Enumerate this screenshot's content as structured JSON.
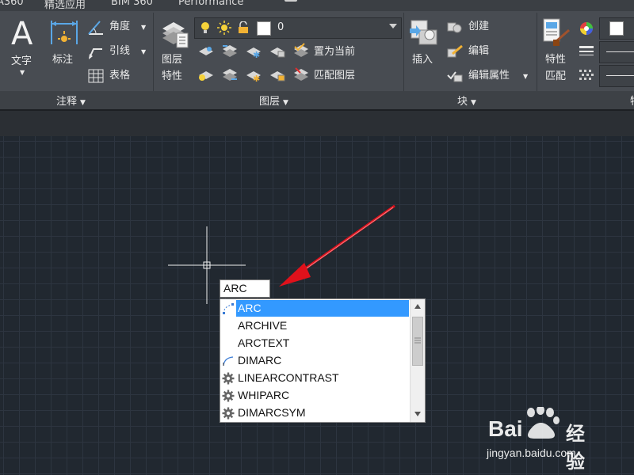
{
  "tabs": [
    "A360",
    "精选应用",
    "BIM 360",
    "Performance"
  ],
  "annotation_panel": {
    "title": "注释",
    "text_label": "文字",
    "dim_label": "标注",
    "angle_label": "角度",
    "leader_label": "引线",
    "table_label": "表格"
  },
  "layers_panel": {
    "title": "图层",
    "layer_props_label_1": "图层",
    "layer_props_label_2": "特性",
    "current_layer": "0",
    "set_current_label": "置为当前",
    "match_layer_label": "匹配图层"
  },
  "block_panel": {
    "title": "块",
    "insert_label": "插入",
    "create_label": "创建",
    "edit_label": "编辑",
    "edit_attr_label": "编辑属性"
  },
  "properties_panel": {
    "match_label_1": "特性",
    "match_label_2": "匹配",
    "title_partial": "特"
  },
  "command": {
    "input_value": "ARC",
    "suggestions": [
      {
        "name": "ARC",
        "icon": "arc-icon",
        "selected": true
      },
      {
        "name": "ARCHIVE",
        "icon": "",
        "selected": false
      },
      {
        "name": "ARCTEXT",
        "icon": "",
        "selected": false
      },
      {
        "name": "DIMARC",
        "icon": "dimarc-icon",
        "selected": false
      },
      {
        "name": "LINEARCONTRAST",
        "icon": "gear-icon",
        "selected": false
      },
      {
        "name": "WHIPARC",
        "icon": "gear-icon",
        "selected": false
      },
      {
        "name": "DIMARCSYM",
        "icon": "gear-icon",
        "selected": false
      }
    ]
  },
  "watermark": {
    "brand": "Bai",
    "brand2": "经验",
    "url": "jingyan.baidu.com"
  },
  "colors": {
    "ribbon_bg": "#484c52",
    "canvas_bg": "#212830",
    "selection": "#3399ff",
    "arrow": "#e0111b"
  }
}
